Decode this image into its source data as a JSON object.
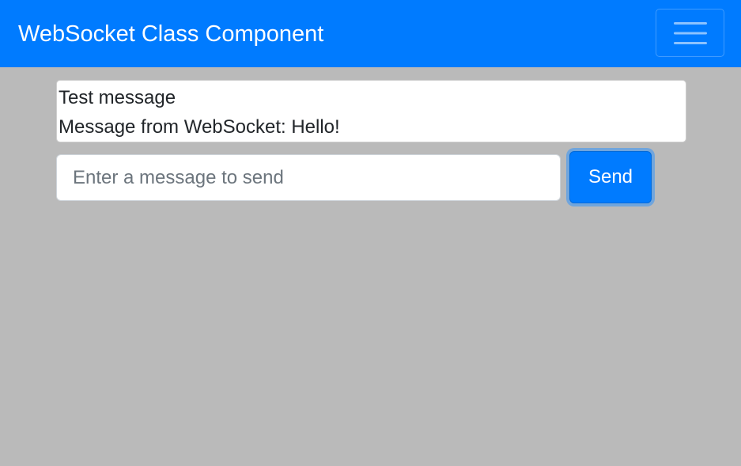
{
  "navbar": {
    "brand": "WebSocket Class Component",
    "toggler_icon": "hamburger-menu-icon",
    "background_color": "#007bff"
  },
  "messages": [
    "Test message",
    "Message from WebSocket: Hello!"
  ],
  "input": {
    "value": "",
    "placeholder": "Enter a message to send"
  },
  "send_button": {
    "label": "Send"
  },
  "colors": {
    "page_background": "#bababa",
    "primary": "#007bff"
  }
}
